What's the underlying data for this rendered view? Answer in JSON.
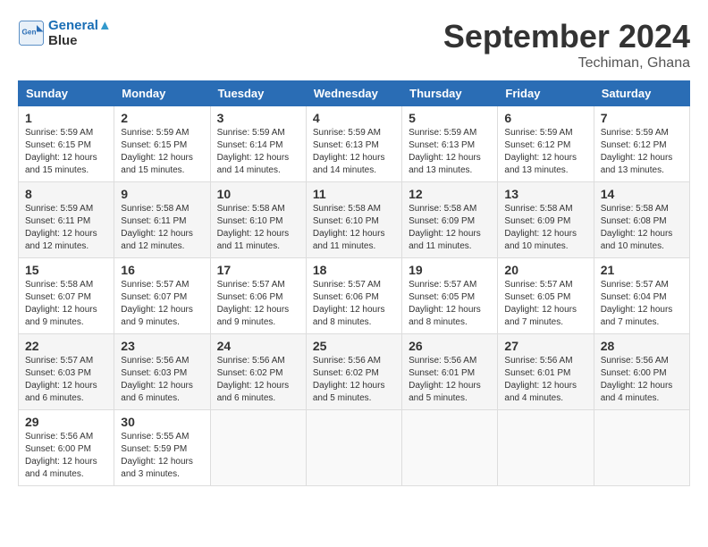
{
  "app": {
    "logo_line1": "General",
    "logo_line2": "Blue"
  },
  "title": "September 2024",
  "location": "Techiman, Ghana",
  "days_of_week": [
    "Sunday",
    "Monday",
    "Tuesday",
    "Wednesday",
    "Thursday",
    "Friday",
    "Saturday"
  ],
  "weeks": [
    [
      {
        "day": "1",
        "sunrise": "5:59 AM",
        "sunset": "6:15 PM",
        "daylight": "12 hours and 15 minutes."
      },
      {
        "day": "2",
        "sunrise": "5:59 AM",
        "sunset": "6:15 PM",
        "daylight": "12 hours and 15 minutes."
      },
      {
        "day": "3",
        "sunrise": "5:59 AM",
        "sunset": "6:14 PM",
        "daylight": "12 hours and 14 minutes."
      },
      {
        "day": "4",
        "sunrise": "5:59 AM",
        "sunset": "6:13 PM",
        "daylight": "12 hours and 14 minutes."
      },
      {
        "day": "5",
        "sunrise": "5:59 AM",
        "sunset": "6:13 PM",
        "daylight": "12 hours and 13 minutes."
      },
      {
        "day": "6",
        "sunrise": "5:59 AM",
        "sunset": "6:12 PM",
        "daylight": "12 hours and 13 minutes."
      },
      {
        "day": "7",
        "sunrise": "5:59 AM",
        "sunset": "6:12 PM",
        "daylight": "12 hours and 13 minutes."
      }
    ],
    [
      {
        "day": "8",
        "sunrise": "5:59 AM",
        "sunset": "6:11 PM",
        "daylight": "12 hours and 12 minutes."
      },
      {
        "day": "9",
        "sunrise": "5:58 AM",
        "sunset": "6:11 PM",
        "daylight": "12 hours and 12 minutes."
      },
      {
        "day": "10",
        "sunrise": "5:58 AM",
        "sunset": "6:10 PM",
        "daylight": "12 hours and 11 minutes."
      },
      {
        "day": "11",
        "sunrise": "5:58 AM",
        "sunset": "6:10 PM",
        "daylight": "12 hours and 11 minutes."
      },
      {
        "day": "12",
        "sunrise": "5:58 AM",
        "sunset": "6:09 PM",
        "daylight": "12 hours and 11 minutes."
      },
      {
        "day": "13",
        "sunrise": "5:58 AM",
        "sunset": "6:09 PM",
        "daylight": "12 hours and 10 minutes."
      },
      {
        "day": "14",
        "sunrise": "5:58 AM",
        "sunset": "6:08 PM",
        "daylight": "12 hours and 10 minutes."
      }
    ],
    [
      {
        "day": "15",
        "sunrise": "5:58 AM",
        "sunset": "6:07 PM",
        "daylight": "12 hours and 9 minutes."
      },
      {
        "day": "16",
        "sunrise": "5:57 AM",
        "sunset": "6:07 PM",
        "daylight": "12 hours and 9 minutes."
      },
      {
        "day": "17",
        "sunrise": "5:57 AM",
        "sunset": "6:06 PM",
        "daylight": "12 hours and 9 minutes."
      },
      {
        "day": "18",
        "sunrise": "5:57 AM",
        "sunset": "6:06 PM",
        "daylight": "12 hours and 8 minutes."
      },
      {
        "day": "19",
        "sunrise": "5:57 AM",
        "sunset": "6:05 PM",
        "daylight": "12 hours and 8 minutes."
      },
      {
        "day": "20",
        "sunrise": "5:57 AM",
        "sunset": "6:05 PM",
        "daylight": "12 hours and 7 minutes."
      },
      {
        "day": "21",
        "sunrise": "5:57 AM",
        "sunset": "6:04 PM",
        "daylight": "12 hours and 7 minutes."
      }
    ],
    [
      {
        "day": "22",
        "sunrise": "5:57 AM",
        "sunset": "6:03 PM",
        "daylight": "12 hours and 6 minutes."
      },
      {
        "day": "23",
        "sunrise": "5:56 AM",
        "sunset": "6:03 PM",
        "daylight": "12 hours and 6 minutes."
      },
      {
        "day": "24",
        "sunrise": "5:56 AM",
        "sunset": "6:02 PM",
        "daylight": "12 hours and 6 minutes."
      },
      {
        "day": "25",
        "sunrise": "5:56 AM",
        "sunset": "6:02 PM",
        "daylight": "12 hours and 5 minutes."
      },
      {
        "day": "26",
        "sunrise": "5:56 AM",
        "sunset": "6:01 PM",
        "daylight": "12 hours and 5 minutes."
      },
      {
        "day": "27",
        "sunrise": "5:56 AM",
        "sunset": "6:01 PM",
        "daylight": "12 hours and 4 minutes."
      },
      {
        "day": "28",
        "sunrise": "5:56 AM",
        "sunset": "6:00 PM",
        "daylight": "12 hours and 4 minutes."
      }
    ],
    [
      {
        "day": "29",
        "sunrise": "5:56 AM",
        "sunset": "6:00 PM",
        "daylight": "12 hours and 4 minutes."
      },
      {
        "day": "30",
        "sunrise": "5:55 AM",
        "sunset": "5:59 PM",
        "daylight": "12 hours and 3 minutes."
      },
      null,
      null,
      null,
      null,
      null
    ]
  ],
  "labels": {
    "sunrise_prefix": "Sunrise: ",
    "sunset_prefix": "Sunset: ",
    "daylight_prefix": "Daylight: "
  }
}
